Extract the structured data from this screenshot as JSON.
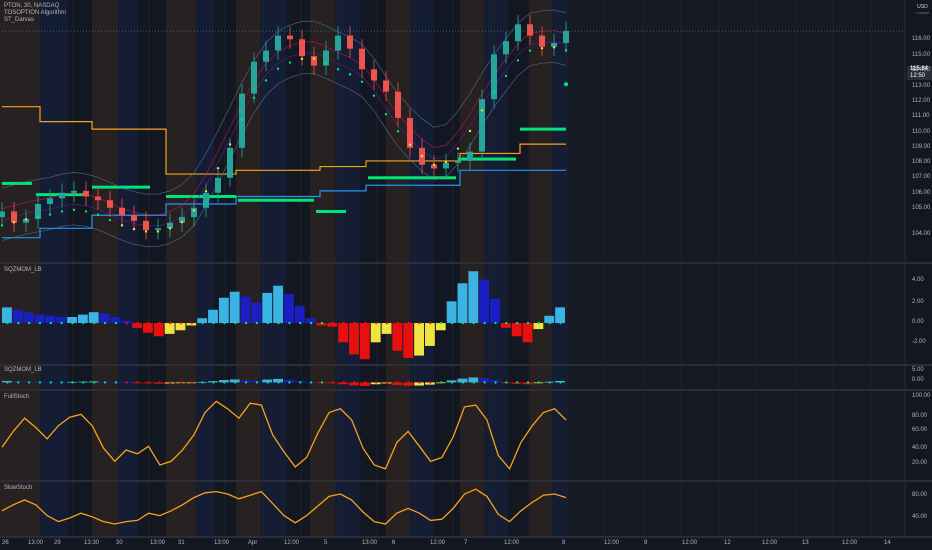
{
  "header": {
    "symbol_line": "PTON, 30, NASDAQ",
    "indicator_1": "TOSOPTION Algorithm",
    "indicator_2": "ST_Darvas",
    "currency": "USD",
    "currency_sub": "Locked"
  },
  "last_price": {
    "value": "115.84",
    "countdown": "12:50"
  },
  "panes": [
    {
      "id": "price",
      "label": "",
      "ticks": [
        "116.00",
        "115.00",
        "114.00",
        "113.00",
        "112.00",
        "111.00",
        "110.00",
        "109.00",
        "108.00",
        "107.00",
        "106.00",
        "105.00",
        "104.00"
      ]
    },
    {
      "id": "sqzmom1",
      "label": "SQZMOM_LB",
      "ticks": [
        "4.00",
        "2.00",
        "0.00",
        "-2.00"
      ]
    },
    {
      "id": "sqzmom2",
      "label": "SQZMOM_LB",
      "ticks": [
        "5.00",
        "0.00"
      ]
    },
    {
      "id": "fullstoch",
      "label": "FullStoch",
      "ticks": [
        "100.00",
        "80.00",
        "60.00",
        "40.00",
        "20.00"
      ]
    },
    {
      "id": "slowstoch",
      "label": "SlowStoch",
      "ticks": [
        "80.00",
        "40.00"
      ]
    }
  ],
  "time_axis": [
    "26",
    "13:00",
    "29",
    "13:30",
    "30",
    "13:00",
    "31",
    "13:00",
    "Apr",
    "12:00",
    "5",
    "13:00",
    "6",
    "12:00",
    "7",
    "12:00",
    "8",
    "12:00",
    "9",
    "12:00",
    "12",
    "12:00",
    "13",
    "12:00",
    "14"
  ],
  "colors": {
    "background": "#131722",
    "up_candle": "#26a69a",
    "down_candle": "#ef5350",
    "orange_line": "#f7a21b",
    "blue_line": "#2196f3",
    "green_darvas": "#00e676",
    "hist_cyan": "#3bb3e4",
    "hist_blue": "#1a1fc4",
    "hist_red": "#e80f0f",
    "hist_yellow": "#f0e442",
    "stoch_line": "#f7a21b"
  },
  "chart_data": {
    "type": "line",
    "title": "PTON, 30, NASDAQ",
    "xlabel": "",
    "ylabel": "",
    "ylim": [
      103.5,
      117.5
    ],
    "series": [
      {
        "name": "",
        "values": [
          106.2,
          105.6,
          105.8,
          106.6,
          106.9,
          107.2,
          107.3,
          107.0,
          106.8,
          106.4,
          106.0,
          105.7,
          105.2,
          105.3,
          105.6,
          105.9,
          106.4,
          107.2,
          108.0,
          109.6,
          112.5,
          114.2,
          114.8,
          115.6,
          115.4,
          114.5,
          114.0,
          114.8,
          115.6,
          114.9,
          113.8,
          113.2,
          112.6,
          111.2,
          109.6,
          108.7,
          108.5,
          108.8,
          108.9,
          109.4,
          112.2,
          114.6,
          115.3,
          116.2,
          115.6,
          115.0,
          115.2,
          115.84
        ]
      }
    ]
  },
  "osc_data": {
    "sqz_hist": [
      1.3,
      1.1,
      0.9,
      0.7,
      0.6,
      0.5,
      0.5,
      0.7,
      0.9,
      0.8,
      0.5,
      0.2,
      -0.4,
      -0.8,
      -1.1,
      -0.9,
      -0.6,
      -0.2,
      0.4,
      1.1,
      2.1,
      2.6,
      2.2,
      1.7,
      2.5,
      3.1,
      2.4,
      1.4,
      0.4,
      -0.2,
      -0.3,
      -1.6,
      -2.6,
      -3.0,
      -1.6,
      -0.9,
      -2.3,
      -2.9,
      -2.7,
      -1.9,
      -0.6,
      1.8,
      3.3,
      4.3,
      3.6,
      2.0,
      -0.4,
      -1.1,
      -1.6,
      -0.5,
      0.6,
      1.3
    ],
    "full_stoch": [
      45,
      62,
      76,
      66,
      54,
      68,
      77,
      80,
      68,
      44,
      30,
      42,
      38,
      46,
      26,
      30,
      42,
      58,
      82,
      94,
      86,
      76,
      92,
      90,
      58,
      40,
      24,
      34,
      60,
      82,
      86,
      74,
      44,
      26,
      22,
      50,
      62,
      46,
      30,
      34,
      56,
      88,
      90,
      74,
      36,
      22,
      50,
      68,
      82,
      86,
      74
    ],
    "slow_stoch": [
      52,
      62,
      70,
      62,
      44,
      34,
      40,
      48,
      42,
      34,
      30,
      34,
      36,
      48,
      44,
      52,
      62,
      74,
      82,
      84,
      80,
      72,
      78,
      84,
      64,
      44,
      32,
      44,
      60,
      76,
      80,
      70,
      50,
      34,
      30,
      48,
      56,
      48,
      36,
      38,
      56,
      80,
      88,
      76,
      46,
      34,
      52,
      66,
      78,
      80,
      74
    ]
  }
}
